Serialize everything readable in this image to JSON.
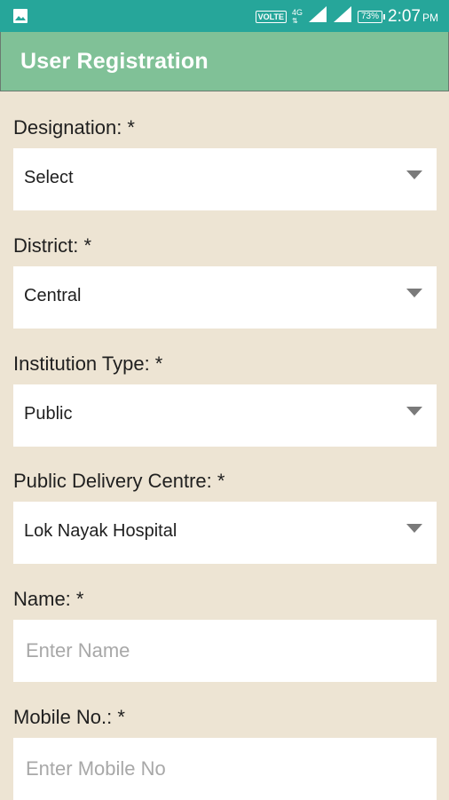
{
  "status_bar": {
    "volte": "VOLTE",
    "network": "4G",
    "battery": "73%",
    "time": "2:07",
    "ampm": "PM",
    "icons": [
      "image-icon",
      "signal-icon",
      "signal-icon",
      "battery-icon"
    ]
  },
  "app_bar": {
    "title": "User Registration",
    "color": "#80c197"
  },
  "form": {
    "designation": {
      "label": "Designation: *",
      "value": "Select"
    },
    "district": {
      "label": "District: *",
      "value": "Central"
    },
    "institution_type": {
      "label": "Institution Type: *",
      "value": "Public"
    },
    "delivery_centre": {
      "label": "Public Delivery Centre: *",
      "value": "Lok Nayak Hospital"
    },
    "name": {
      "label": "Name: *",
      "placeholder": "Enter Name"
    },
    "mobile": {
      "label": "Mobile No.: *",
      "placeholder": "Enter Mobile No"
    }
  },
  "colors": {
    "status_bar": "#26a69a",
    "background": "#ede4d3"
  }
}
